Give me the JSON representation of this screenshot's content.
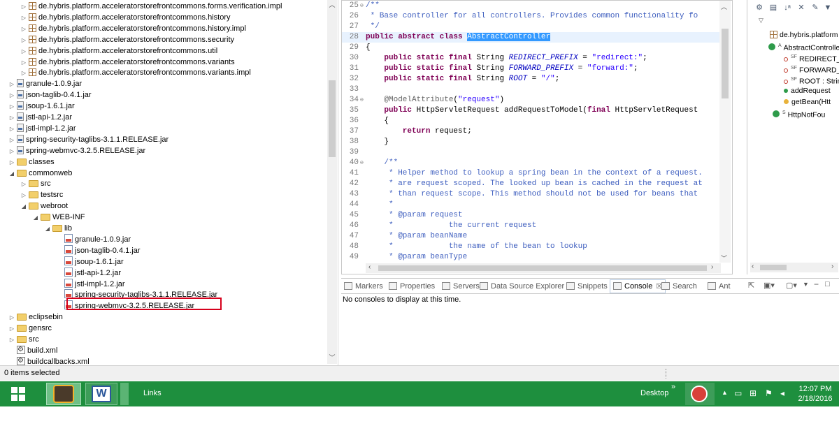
{
  "explorer": {
    "rows": [
      {
        "indent": 3,
        "twisty": "▷",
        "icon": "pkg",
        "label": "de.hybris.platform.acceleratorstorefrontcommons.forms.verification.impl"
      },
      {
        "indent": 3,
        "twisty": "▷",
        "icon": "pkg",
        "label": "de.hybris.platform.acceleratorstorefrontcommons.history"
      },
      {
        "indent": 3,
        "twisty": "▷",
        "icon": "pkg",
        "label": "de.hybris.platform.acceleratorstorefrontcommons.history.impl"
      },
      {
        "indent": 3,
        "twisty": "▷",
        "icon": "pkg",
        "label": "de.hybris.platform.acceleratorstorefrontcommons.security"
      },
      {
        "indent": 3,
        "twisty": "▷",
        "icon": "pkg",
        "label": "de.hybris.platform.acceleratorstorefrontcommons.util"
      },
      {
        "indent": 3,
        "twisty": "▷",
        "icon": "pkg",
        "label": "de.hybris.platform.acceleratorstorefrontcommons.variants"
      },
      {
        "indent": 3,
        "twisty": "▷",
        "icon": "pkg",
        "label": "de.hybris.platform.acceleratorstorefrontcommons.variants.impl"
      },
      {
        "indent": 2,
        "twisty": "▷",
        "icon": "jar",
        "label": "granule-1.0.9.jar"
      },
      {
        "indent": 2,
        "twisty": "▷",
        "icon": "jar",
        "label": "json-taglib-0.4.1.jar"
      },
      {
        "indent": 2,
        "twisty": "▷",
        "icon": "jar",
        "label": "jsoup-1.6.1.jar"
      },
      {
        "indent": 2,
        "twisty": "▷",
        "icon": "jar",
        "label": "jstl-api-1.2.jar"
      },
      {
        "indent": 2,
        "twisty": "▷",
        "icon": "jar",
        "label": "jstl-impl-1.2.jar"
      },
      {
        "indent": 2,
        "twisty": "▷",
        "icon": "jar",
        "label": "spring-security-taglibs-3.1.1.RELEASE.jar"
      },
      {
        "indent": 2,
        "twisty": "▷",
        "icon": "jar",
        "label": "spring-webmvc-3.2.5.RELEASE.jar"
      },
      {
        "indent": 2,
        "twisty": "▷",
        "icon": "folder",
        "label": "classes"
      },
      {
        "indent": 2,
        "twisty": "◢",
        "icon": "folder",
        "label": "commonweb"
      },
      {
        "indent": 3,
        "twisty": "▷",
        "icon": "folder",
        "label": "src"
      },
      {
        "indent": 3,
        "twisty": "▷",
        "icon": "folder",
        "label": "testsrc"
      },
      {
        "indent": 3,
        "twisty": "◢",
        "icon": "folder",
        "label": "webroot"
      },
      {
        "indent": 4,
        "twisty": "◢",
        "icon": "folder",
        "label": "WEB-INF"
      },
      {
        "indent": 5,
        "twisty": "◢",
        "icon": "folder",
        "label": "lib"
      },
      {
        "indent": 6,
        "twisty": "",
        "icon": "file",
        "label": "granule-1.0.9.jar"
      },
      {
        "indent": 6,
        "twisty": "",
        "icon": "file",
        "label": "json-taglib-0.4.1.jar"
      },
      {
        "indent": 6,
        "twisty": "",
        "icon": "file",
        "label": "jsoup-1.6.1.jar"
      },
      {
        "indent": 6,
        "twisty": "",
        "icon": "file",
        "label": "jstl-api-1.2.jar"
      },
      {
        "indent": 6,
        "twisty": "",
        "icon": "file",
        "label": "jstl-impl-1.2.jar"
      },
      {
        "indent": 6,
        "twisty": "",
        "icon": "file",
        "label": "spring-security-taglibs-3.1.1.RELEASE.jar"
      },
      {
        "indent": 6,
        "twisty": "",
        "icon": "file",
        "label": "spring-webmvc-3.2.5.RELEASE.jar"
      },
      {
        "indent": 2,
        "twisty": "▷",
        "icon": "folder",
        "label": "eclipsebin"
      },
      {
        "indent": 2,
        "twisty": "▷",
        "icon": "folder",
        "label": "gensrc"
      },
      {
        "indent": 2,
        "twisty": "▷",
        "icon": "folder",
        "label": "src"
      },
      {
        "indent": 2,
        "twisty": "",
        "icon": "xml",
        "label": "build.xml"
      },
      {
        "indent": 2,
        "twisty": "",
        "icon": "xml",
        "label": "buildcallbacks.xml"
      }
    ]
  },
  "editor": {
    "lines": [
      {
        "n": "25",
        "fold": "⊖",
        "parts": [
          {
            "c": "cmt",
            "t": "/**"
          }
        ]
      },
      {
        "n": "26",
        "fold": "",
        "parts": [
          {
            "c": "cmt",
            "t": " * Base controller for all controllers. Provides common functionality fo"
          }
        ]
      },
      {
        "n": "27",
        "fold": "",
        "parts": [
          {
            "c": "cmt",
            "t": " */"
          }
        ]
      },
      {
        "n": "28",
        "fold": "",
        "parts": [
          {
            "c": "kw",
            "t": "public abstract class "
          },
          {
            "c": "sel",
            "t": "AbstractController"
          }
        ]
      },
      {
        "n": "29",
        "fold": "",
        "parts": [
          {
            "c": "txt",
            "t": "{"
          }
        ]
      },
      {
        "n": "30",
        "fold": "",
        "parts": [
          {
            "c": "kw",
            "t": "    public static final "
          },
          {
            "c": "txt",
            "t": "String "
          },
          {
            "c": "fld",
            "t": "REDIRECT_PREFIX"
          },
          {
            "c": "txt",
            "t": " = "
          },
          {
            "c": "str",
            "t": "\"redirect:\""
          },
          {
            "c": "txt",
            "t": ";"
          }
        ]
      },
      {
        "n": "31",
        "fold": "",
        "parts": [
          {
            "c": "kw",
            "t": "    public static final "
          },
          {
            "c": "txt",
            "t": "String "
          },
          {
            "c": "fld",
            "t": "FORWARD_PREFIX"
          },
          {
            "c": "txt",
            "t": " = "
          },
          {
            "c": "str",
            "t": "\"forward:\""
          },
          {
            "c": "txt",
            "t": ";"
          }
        ]
      },
      {
        "n": "32",
        "fold": "",
        "parts": [
          {
            "c": "kw",
            "t": "    public static final "
          },
          {
            "c": "txt",
            "t": "String "
          },
          {
            "c": "fld",
            "t": "ROOT"
          },
          {
            "c": "txt",
            "t": " = "
          },
          {
            "c": "str",
            "t": "\"/\""
          },
          {
            "c": "txt",
            "t": ";"
          }
        ]
      },
      {
        "n": "33",
        "fold": "",
        "parts": [
          {
            "c": "txt",
            "t": ""
          }
        ]
      },
      {
        "n": "34",
        "fold": "⊖",
        "parts": [
          {
            "c": "ann",
            "t": "    @ModelAttribute"
          },
          {
            "c": "txt",
            "t": "("
          },
          {
            "c": "str",
            "t": "\"request\""
          },
          {
            "c": "txt",
            "t": ")"
          }
        ]
      },
      {
        "n": "35",
        "fold": "",
        "parts": [
          {
            "c": "kw",
            "t": "    public "
          },
          {
            "c": "txt",
            "t": "HttpServletRequest addRequestToModel("
          },
          {
            "c": "kw",
            "t": "final "
          },
          {
            "c": "txt",
            "t": "HttpServletRequest"
          }
        ]
      },
      {
        "n": "36",
        "fold": "",
        "parts": [
          {
            "c": "txt",
            "t": "    {"
          }
        ]
      },
      {
        "n": "37",
        "fold": "",
        "parts": [
          {
            "c": "kw",
            "t": "        return "
          },
          {
            "c": "txt",
            "t": "request;"
          }
        ]
      },
      {
        "n": "38",
        "fold": "",
        "parts": [
          {
            "c": "txt",
            "t": "    }"
          }
        ]
      },
      {
        "n": "39",
        "fold": "",
        "parts": [
          {
            "c": "txt",
            "t": ""
          }
        ]
      },
      {
        "n": "40",
        "fold": "⊖",
        "parts": [
          {
            "c": "cmt",
            "t": "    /**"
          }
        ]
      },
      {
        "n": "41",
        "fold": "",
        "parts": [
          {
            "c": "cmt",
            "t": "     * Helper method to lookup a spring bean in the context of a request."
          }
        ]
      },
      {
        "n": "42",
        "fold": "",
        "parts": [
          {
            "c": "cmt",
            "t": "     * are request scoped. The looked up bean is cached in the request at"
          }
        ]
      },
      {
        "n": "43",
        "fold": "",
        "parts": [
          {
            "c": "cmt",
            "t": "     * than request scope. This method should not be used for beans that"
          }
        ]
      },
      {
        "n": "44",
        "fold": "",
        "parts": [
          {
            "c": "cmt",
            "t": "     *"
          }
        ]
      },
      {
        "n": "45",
        "fold": "",
        "parts": [
          {
            "c": "cmt",
            "t": "     * @param request"
          }
        ]
      },
      {
        "n": "46",
        "fold": "",
        "parts": [
          {
            "c": "cmt",
            "t": "     *            the current request"
          }
        ]
      },
      {
        "n": "47",
        "fold": "",
        "parts": [
          {
            "c": "cmt",
            "t": "     * @param beanName"
          }
        ]
      },
      {
        "n": "48",
        "fold": "",
        "parts": [
          {
            "c": "cmt",
            "t": "     *            the name of the bean to lookup"
          }
        ]
      },
      {
        "n": "49",
        "fold": "",
        "parts": [
          {
            "c": "cmt",
            "t": "     * @param beanType"
          }
        ]
      }
    ]
  },
  "outline": {
    "rows": [
      {
        "label": "de.hybris.platform",
        "kind": "pkg"
      },
      {
        "label": "AbstractControlle",
        "kind": "class",
        "badge": "A"
      },
      {
        "label": "REDIRECT_P",
        "kind": "field",
        "badge": "SF"
      },
      {
        "label": "FORWARD_P",
        "kind": "field",
        "badge": "SF"
      },
      {
        "label": "ROOT : Strin",
        "kind": "field",
        "badge": "SF"
      },
      {
        "label": "addRequest",
        "kind": "method-public"
      },
      {
        "label": "getBean(Htt",
        "kind": "method-protected"
      },
      {
        "label": "HttpNotFou",
        "kind": "class",
        "badge": "S"
      }
    ]
  },
  "console": {
    "tabs": [
      "Markers",
      "Properties",
      "Servers",
      "Data Source Explorer",
      "Snippets",
      "Console",
      "Search",
      "Ant"
    ],
    "active_tab": "Console",
    "message": "No consoles to display at this time."
  },
  "statusbar": {
    "text": "0 items selected"
  },
  "taskbar": {
    "toolbar_label": "Links",
    "desktop_label": "Desktop",
    "time": "12:07 PM",
    "date": "2/18/2016",
    "accent": "#1e8f3e"
  }
}
